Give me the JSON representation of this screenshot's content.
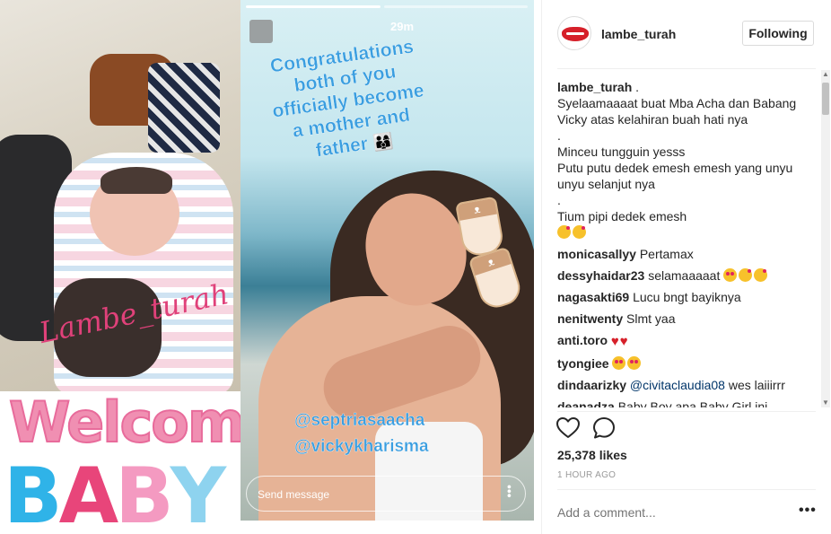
{
  "media": {
    "watermark": "Lambe_turah",
    "welcome_text": "Welcome",
    "baby_letters": [
      "B",
      "A",
      "B",
      "Y"
    ],
    "baby_colors": [
      "#2fb3e8",
      "#e8457a",
      "#f49ac1",
      "#8ed3ef"
    ],
    "story": {
      "time": "29m",
      "congrats_lines": [
        "Congratulations",
        "both of you",
        "officially become",
        "a mother and",
        "father"
      ],
      "congrats_emoji": "👨‍👩‍👦",
      "handles": [
        "@septriasaacha",
        "@vickykharisma"
      ],
      "send_placeholder": "Send message",
      "sock_label": "ᴥ"
    }
  },
  "post": {
    "username": "lambe_turah",
    "follow_label": "Following",
    "caption": {
      "username": "lambe_turah",
      "dot": ".",
      "lines": [
        "Syelaamaaaat buat Mba Acha dan Babang Vicky atas kelahiran buah hati nya",
        ".",
        "Minceu tungguin yesss",
        "Putu putu dedek emesh emesh yang unyu unyu selanjut nya",
        ".",
        "Tium pipi dedek emesh"
      ]
    },
    "comments": [
      {
        "user": "monicasallyy",
        "text": "Pertamax"
      },
      {
        "user": "dessyhaidar23",
        "text": "selamaaaaat"
      },
      {
        "user": "nagasakti69",
        "text": "Lucu bngt bayiknya"
      },
      {
        "user": "nenitwenty",
        "text": "Slmt yaa"
      },
      {
        "user": "anti.toro",
        "text": ""
      },
      {
        "user": "tyongiee",
        "text": ""
      },
      {
        "user": "dindaarizky",
        "mention": "@civitaclaudia08",
        "text": "wes laiiirrr"
      },
      {
        "user": "deanadza",
        "text": "Baby Boy apa Baby Girl ini"
      }
    ],
    "likes": "25,378 likes",
    "time": "1 HOUR AGO",
    "add_comment_placeholder": "Add a comment...",
    "more_label": "•••"
  },
  "icons": {
    "like": "heart-outline-icon",
    "comment": "speech-bubble-icon",
    "more": "more-options-icon"
  }
}
